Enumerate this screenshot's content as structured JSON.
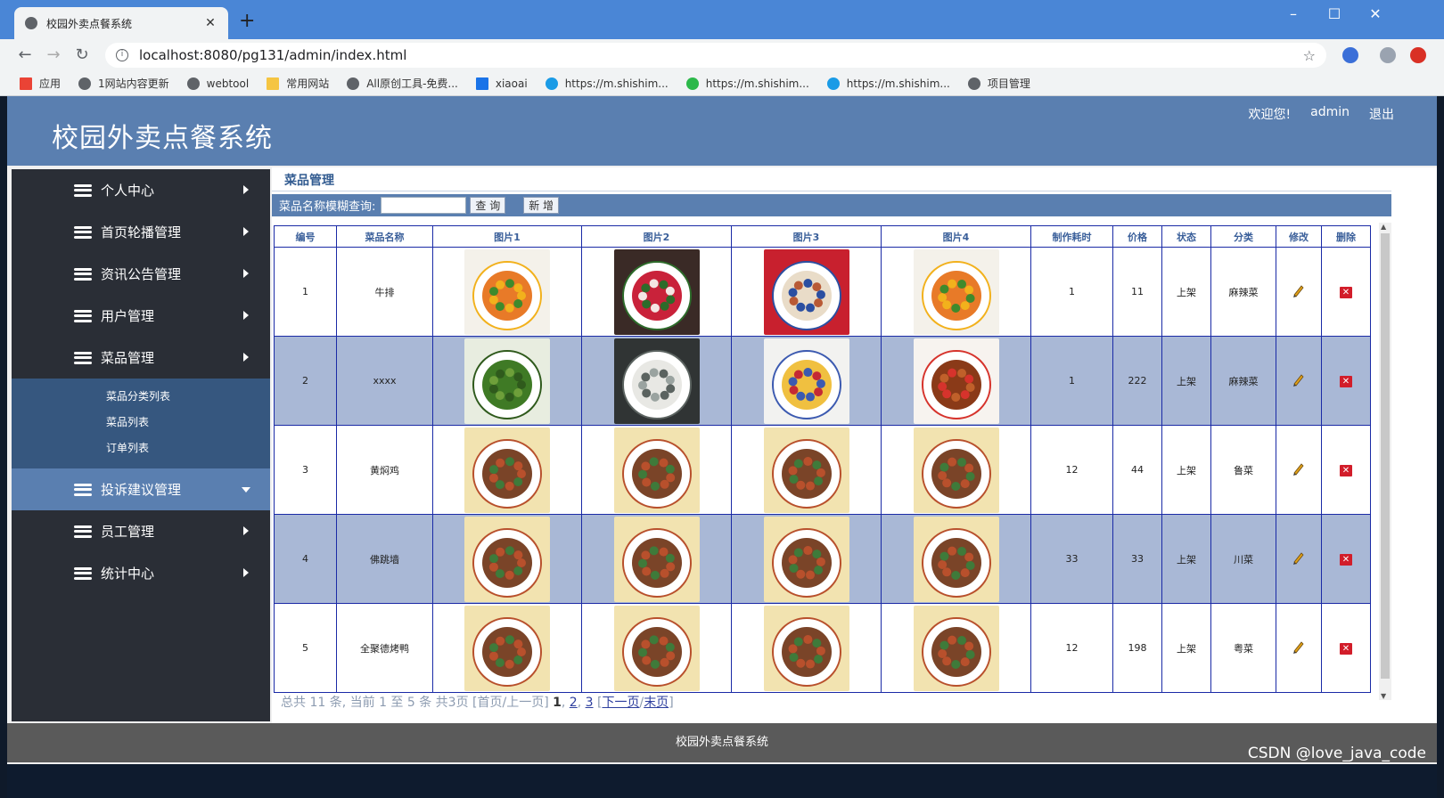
{
  "browser": {
    "tab_title": "校园外卖点餐系统",
    "new_tab": "+",
    "url": "localhost:8080/pg131/admin/index.html",
    "bookmarks": [
      "应用",
      "1网站内容更新",
      "webtool",
      "常用网站",
      "All原创工具-免费...",
      "xiaoai",
      "https://m.shishim...",
      "https://m.shishim...",
      "https://m.shishim...",
      "项目管理"
    ]
  },
  "header": {
    "title": "校园外卖点餐系统",
    "welcome": "欢迎您!",
    "user": "admin",
    "logout": "退出"
  },
  "sidebar": {
    "items": [
      {
        "label": "个人中心"
      },
      {
        "label": "首页轮播管理"
      },
      {
        "label": "资讯公告管理"
      },
      {
        "label": "用户管理"
      },
      {
        "label": "菜品管理"
      },
      {
        "label": "投诉建议管理"
      },
      {
        "label": "员工管理"
      },
      {
        "label": "统计中心"
      }
    ],
    "submenu": [
      "菜品分类列表",
      "菜品列表",
      "订单列表"
    ]
  },
  "main": {
    "breadcrumb": "菜品管理",
    "search_label": "菜品名称模糊查询:",
    "search_value": "",
    "query_button": "查 询",
    "add_button": "新 增",
    "columns": [
      "编号",
      "菜品名称",
      "图片1",
      "图片2",
      "图片3",
      "图片4",
      "制作耗时",
      "价格",
      "状态",
      "分类",
      "修改",
      "删除"
    ],
    "rows": [
      {
        "id": "1",
        "name": "牛排",
        "images": [
          "carrot-greens-stirfry",
          "radish-flower",
          "steamed-fish",
          "carrot-greens-stirfry"
        ],
        "time": "1",
        "price": "11",
        "status": "上架",
        "category": "麻辣菜"
      },
      {
        "id": "2",
        "name": "xxxx",
        "images": [
          "green-beans",
          "tofu-soup",
          "egg-tarts",
          "braised-wings"
        ],
        "time": "1",
        "price": "222",
        "status": "上架",
        "category": "麻辣菜"
      },
      {
        "id": "3",
        "name": "黄焖鸡",
        "images": [
          "braised-chicken-bowl",
          "braised-chicken-bowl",
          "braised-chicken-bowl",
          "braised-chicken-bowl"
        ],
        "time": "12",
        "price": "44",
        "status": "上架",
        "category": "鲁菜"
      },
      {
        "id": "4",
        "name": "佛跳墙",
        "images": [
          "braised-chicken-bowl",
          "braised-chicken-bowl",
          "braised-chicken-bowl",
          "braised-chicken-bowl"
        ],
        "time": "33",
        "price": "33",
        "status": "上架",
        "category": "川菜"
      },
      {
        "id": "5",
        "name": "全聚德烤鸭",
        "images": [
          "braised-chicken-bowl",
          "braised-chicken-bowl",
          "braised-chicken-bowl",
          "braised-chicken-bowl"
        ],
        "time": "12",
        "price": "198",
        "status": "上架",
        "category": "粤菜"
      }
    ],
    "pager": {
      "summary": "总共 11 条, 当前 1 至 5 条 共3页",
      "first_prev": "[首页/上一页]",
      "pages": [
        "1",
        "2",
        "3"
      ],
      "next": "下一页",
      "last": "末页"
    }
  },
  "footer": {
    "text": "校园外卖点餐系统"
  },
  "watermark": "CSDN @love_java_code",
  "colors": {
    "header": "#5a7fb0",
    "sidebar": "#2a2e36",
    "submenu": "#36577f",
    "alt_row": "#a9b8d6",
    "delete": "#d21d2a"
  }
}
